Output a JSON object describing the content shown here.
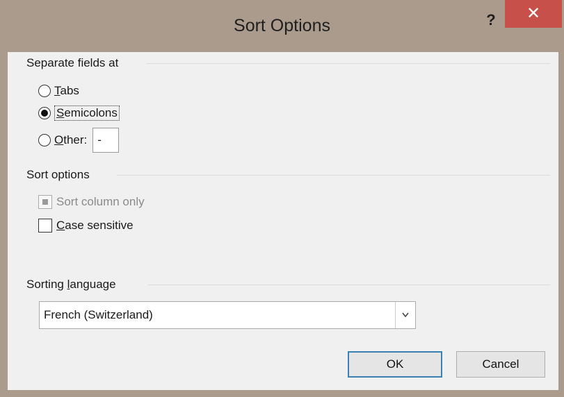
{
  "window": {
    "title": "Sort Options",
    "help_label": "?",
    "close_label": "✕"
  },
  "separate_fields": {
    "header": "Separate fields at",
    "options": [
      {
        "label_mnemonic": "T",
        "label_rest": "abs",
        "checked": false
      },
      {
        "label_mnemonic": "S",
        "label_rest": "emicolons",
        "checked": true
      },
      {
        "label_mnemonic": "O",
        "label_rest": "ther:",
        "checked": false
      }
    ],
    "other_value": "-"
  },
  "sort_options": {
    "header": "Sort options",
    "sort_column_only": "Sort column only",
    "case_sensitive_mnemonic": "C",
    "case_sensitive_rest": "ase sensitive"
  },
  "sorting_language": {
    "header_prefix": "Sorting ",
    "header_mnemonic": "l",
    "header_suffix": "anguage",
    "selected": "French (Switzerland)",
    "dropdown_icon": "chevron-down"
  },
  "buttons": {
    "ok": "OK",
    "cancel": "Cancel"
  }
}
